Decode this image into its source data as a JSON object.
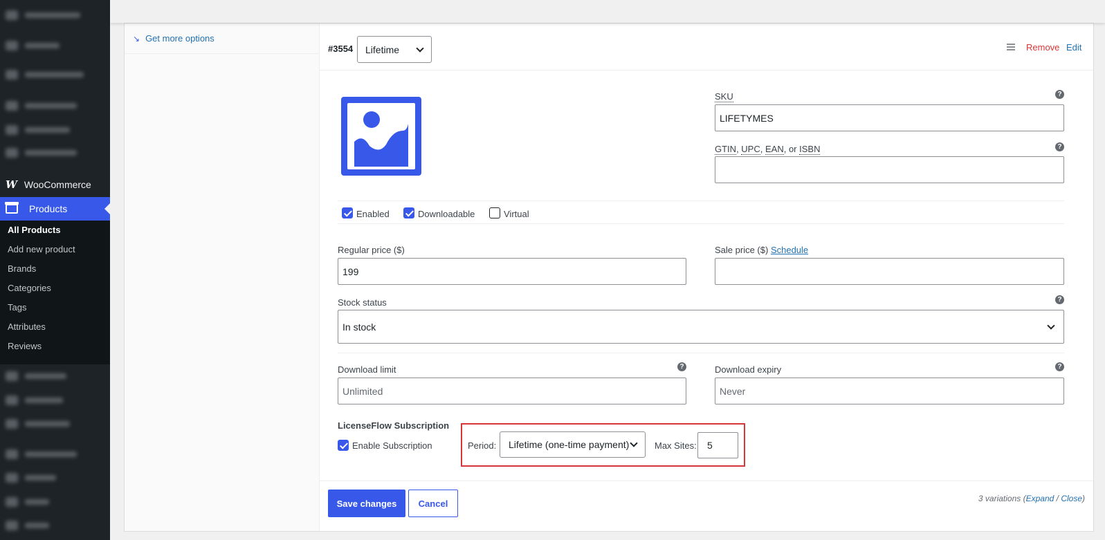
{
  "sidebar": {
    "woocommerce_label": "WooCommerce",
    "products_label": "Products",
    "submenu": [
      "All Products",
      "Add new product",
      "Brands",
      "Categories",
      "Tags",
      "Attributes",
      "Reviews"
    ]
  },
  "left_panel": {
    "get_more_label": "Get more options"
  },
  "variation": {
    "id": "#3554",
    "selected": "Lifetime",
    "remove_label": "Remove",
    "edit_label": "Edit",
    "sku": {
      "label": "SKU",
      "value": "LIFETYMES"
    },
    "gtin": {
      "label_parts": [
        "GTIN",
        ", ",
        "UPC",
        ", ",
        "EAN",
        ", or ",
        "ISBN"
      ],
      "value": ""
    },
    "checkboxes": [
      {
        "label": "Enabled",
        "checked": true
      },
      {
        "label": "Downloadable",
        "checked": true
      },
      {
        "label": "Virtual",
        "checked": false
      }
    ],
    "regular_price": {
      "label": "Regular price ($)",
      "value": "199"
    },
    "sale_price": {
      "label": "Sale price ($)",
      "schedule_link": "Schedule",
      "value": ""
    },
    "stock_status": {
      "label": "Stock status",
      "value": "In stock"
    },
    "download_limit": {
      "label": "Download limit",
      "placeholder": "Unlimited"
    },
    "download_expiry": {
      "label": "Download expiry",
      "placeholder": "Never"
    },
    "licenseflow": {
      "title": "LicenseFlow Subscription",
      "enable_label": "Enable Subscription",
      "enabled": true,
      "period_label": "Period:",
      "period_value": "Lifetime (one-time payment)",
      "max_sites_label": "Max Sites:",
      "max_sites_value": "5"
    }
  },
  "footer": {
    "save_label": "Save changes",
    "cancel_label": "Cancel",
    "count_text": "3 variations (",
    "expand_label": "Expand",
    "sep": " / ",
    "close_label": "Close",
    "close_paren": ")"
  },
  "colors": {
    "accent": "#3858e9",
    "danger": "#d63638",
    "sidebar": "#1d2327",
    "link": "#2271b1"
  },
  "help_glyph": "?"
}
